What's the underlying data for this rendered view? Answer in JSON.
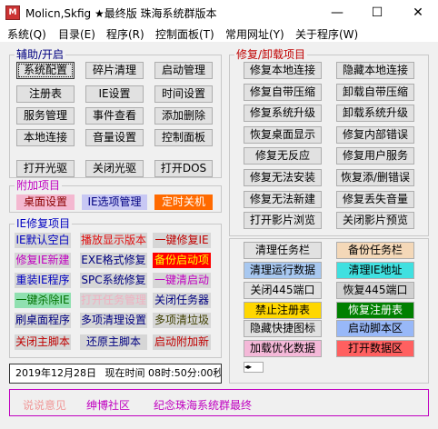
{
  "window": {
    "title": "Molicn,Skfig ★最终版 珠海系统群版本",
    "icon": "app-icon"
  },
  "window_controls": {
    "minimize": "—",
    "maximize": "☐",
    "close": "✕"
  },
  "menu": [
    "系统(Q)",
    "目录(E)",
    "程序(R)",
    "控制面板(T)",
    "常用网址(Y)",
    "关于程序(W)"
  ],
  "assist": {
    "label": "辅助/开启",
    "buttons": [
      "系统配置",
      "碎片清理",
      "启动管理",
      "注册表",
      "IE设置",
      "时间设置",
      "服务管理",
      "事件查看",
      "添加删除",
      "本地连接",
      "音量设置",
      "控制面板",
      "打开光驱",
      "关闭光驱",
      "打开DOS"
    ]
  },
  "extra": {
    "label": "附加项目",
    "buttons": [
      {
        "label": "桌面设置",
        "bg": "#f4b8d0",
        "color": "#8b0000"
      },
      {
        "label": "IE选项管理",
        "bg": "#c8c8f4",
        "color": "#000080"
      },
      {
        "label": "定时关机",
        "bg": "#ff6a00",
        "color": "#ffffff"
      }
    ]
  },
  "ie_repair": {
    "label": "IE修复项目",
    "buttons": [
      {
        "label": "IE默认空白",
        "bg": "#d6d6d6",
        "color": "#0000c0"
      },
      {
        "label": "播放显示版本",
        "bg": "#d6d6d6",
        "color": "#e01010"
      },
      {
        "label": "一键修复IE",
        "bg": "#d6d6d6",
        "color": "#c00000"
      },
      {
        "label": "修复IE新建",
        "bg": "#d6d6d6",
        "color": "#c000c0"
      },
      {
        "label": "EXE格式修复",
        "bg": "#d6d6d6",
        "color": "#000080"
      },
      {
        "label": "备份启动项",
        "bg": "#ff0000",
        "color": "#ffff00"
      },
      {
        "label": "重装IE程序",
        "bg": "#d6d6d6",
        "color": "#0000c0"
      },
      {
        "label": "SPC系统修复",
        "bg": "#d6d6d6",
        "color": "#000080"
      },
      {
        "label": "一键清启动",
        "bg": "#d6d6d6",
        "color": "#c000c0"
      },
      {
        "label": "一键杀除IE",
        "bg": "#90e0b0",
        "color": "#007000"
      },
      {
        "label": "打开任务管理",
        "bg": "#d6d6d6",
        "color": "#f0b0c0"
      },
      {
        "label": "关闭任务器",
        "bg": "#d6d6d6",
        "color": "#000080"
      },
      {
        "label": "刷桌面程序",
        "bg": "#d6d6d6",
        "color": "#000080"
      },
      {
        "label": "多项清理设置",
        "bg": "#d6d6d6",
        "color": "#000080"
      },
      {
        "label": "多项清垃圾",
        "bg": "#d6d6d6",
        "color": "#404000"
      },
      {
        "label": "关闭主脚本",
        "bg": "#d6d6d6",
        "color": "#c00000"
      },
      {
        "label": "还原主脚本",
        "bg": "#d6d6d6",
        "color": "#000080"
      },
      {
        "label": "启动附加新",
        "bg": "#d6d6d6",
        "color": "#c00000"
      }
    ]
  },
  "repair": {
    "label": "修复/卸载项目",
    "buttons": [
      "修复本地连接",
      "隐藏本地连接",
      "修复自带压缩",
      "卸载自带压缩",
      "修复系统升级",
      "卸载系统升级",
      "恢复桌面显示",
      "修复内部错误",
      "修复无反应",
      "修复用户服务",
      "修复无法安装",
      "恢复添/删错误",
      "修复无法新建",
      "修复丢失音量",
      "打开影片浏览",
      "关闭影片预览"
    ]
  },
  "tools": {
    "buttons": [
      {
        "label": "清理任务栏",
        "bg": "#e1e1e1",
        "color": "#000000"
      },
      {
        "label": "备份任务栏",
        "bg": "#f4d8b8",
        "color": "#000000"
      },
      {
        "label": "清理运行数据",
        "bg": "#a8c8f0",
        "color": "#000000"
      },
      {
        "label": "清理IE地址",
        "bg": "#40e0e0",
        "color": "#000000"
      },
      {
        "label": "关闭445端口",
        "bg": "#e1e1e1",
        "color": "#000000"
      },
      {
        "label": "恢复445端口",
        "bg": "#d0d0d0",
        "color": "#000000"
      },
      {
        "label": "禁止注册表",
        "bg": "#ffd700",
        "color": "#000000"
      },
      {
        "label": "恢复注册表",
        "bg": "#008000",
        "color": "#ffffff"
      },
      {
        "label": "隐藏快捷图标",
        "bg": "#e1e1e1",
        "color": "#000000"
      },
      {
        "label": "启动脚本区",
        "bg": "#98b8f8",
        "color": "#000000"
      },
      {
        "label": "加载优化数据",
        "bg": "#f4b8d8",
        "color": "#000000"
      },
      {
        "label": "打开数据区",
        "bg": "#ff6060",
        "color": "#000000"
      }
    ]
  },
  "status": {
    "date": "2019年12月28日",
    "time_label": "现在时间",
    "hour": "08",
    "minute": "50",
    "second": "00",
    "hour_unit": "时",
    "minute_unit": "分",
    "second_unit": "秒"
  },
  "bottom": {
    "links": [
      {
        "label": "说说意见",
        "color": "#f09898"
      },
      {
        "label": "绅博社区",
        "color": "#c000c0"
      },
      {
        "label": "纪念珠海系统群最终",
        "color": "#c000c0"
      }
    ]
  }
}
